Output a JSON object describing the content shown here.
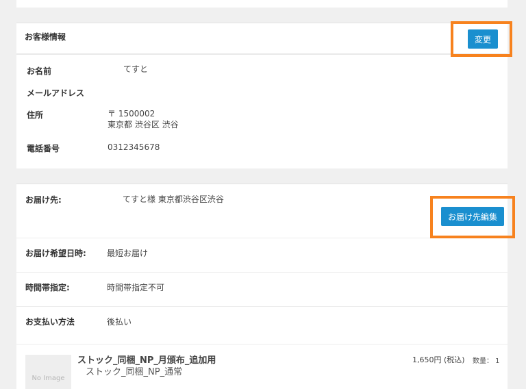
{
  "customer": {
    "title": "お客様情報",
    "change_label": "変更",
    "fields": [
      {
        "label": "お名前",
        "value": "てすと"
      },
      {
        "label": "メールアドレス",
        "value": ""
      },
      {
        "label": "住所",
        "value": "〒 1500002",
        "value2": "東京都 渋谷区 渋谷"
      },
      {
        "label": "電話番号",
        "value": "0312345678"
      }
    ]
  },
  "delivery": {
    "rows": [
      {
        "label": "お届け先:",
        "value": "てすと様 東京都渋谷区渋谷"
      },
      {
        "label": "お届け希望日時:",
        "value": "最短お届け"
      },
      {
        "label": "時間帯指定:",
        "value": "時間帯指定不可"
      },
      {
        "label": "お支払い方法",
        "value": "後払い"
      }
    ],
    "edit_label": "お届け先編集"
  },
  "product": {
    "image_placeholder": "No Image",
    "name": "ストック_同梱_NP_月頒布_追加用",
    "subname": "ストック_同梱_NP_通常",
    "price": "1,650円 (税込)",
    "quantity": "数量： 1"
  },
  "colors": {
    "accent": "#1a8fcf",
    "highlight": "#f7821e",
    "background": "#f0f0f0"
  }
}
